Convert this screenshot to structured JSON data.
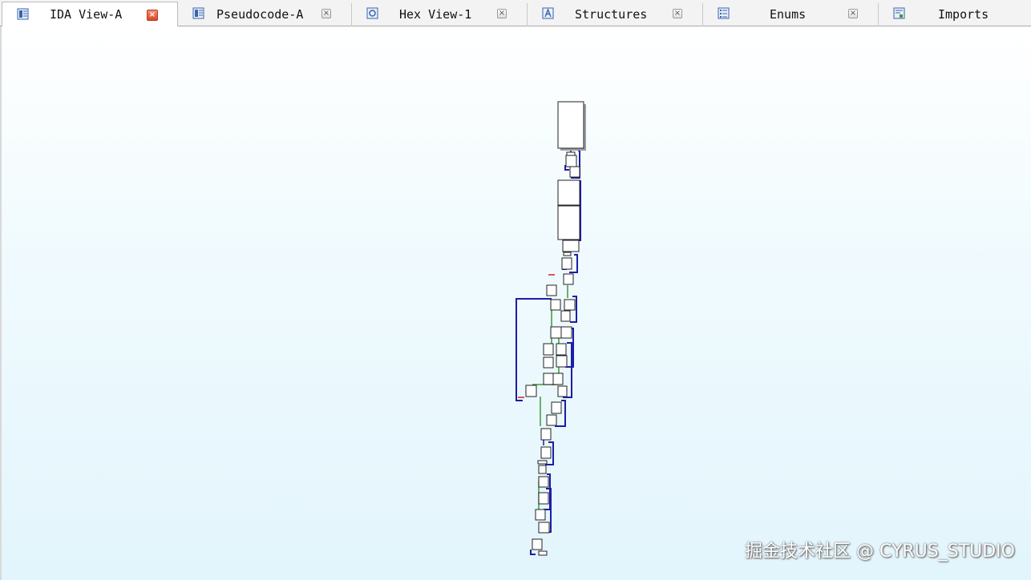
{
  "tabs": [
    {
      "label": "IDA View-A",
      "icon": "ida-view-icon",
      "active": true
    },
    {
      "label": "Pseudocode-A",
      "icon": "pseudocode-icon",
      "active": false
    },
    {
      "label": "Hex View-1",
      "icon": "hex-view-icon",
      "active": false
    },
    {
      "label": "Structures",
      "icon": "structures-icon",
      "active": false
    },
    {
      "label": "Enums",
      "icon": "enums-icon",
      "active": false
    },
    {
      "label": "Imports",
      "icon": "imports-icon",
      "active": false
    }
  ],
  "close_glyph": "×",
  "graph": {
    "view": "graph-overview",
    "edge_colors": {
      "unconditional": "#1c1ca8",
      "true": "#3a9a3a",
      "false": "#cc2222"
    },
    "node_fill": "#ffffff",
    "node_border": "#222222"
  },
  "watermark": "掘金技术社区 @ CYRUS_STUDIO",
  "colors": {
    "background_top": "#ffffff",
    "background_bottom": "#e2f5fc",
    "active_close": "#d9462a"
  }
}
